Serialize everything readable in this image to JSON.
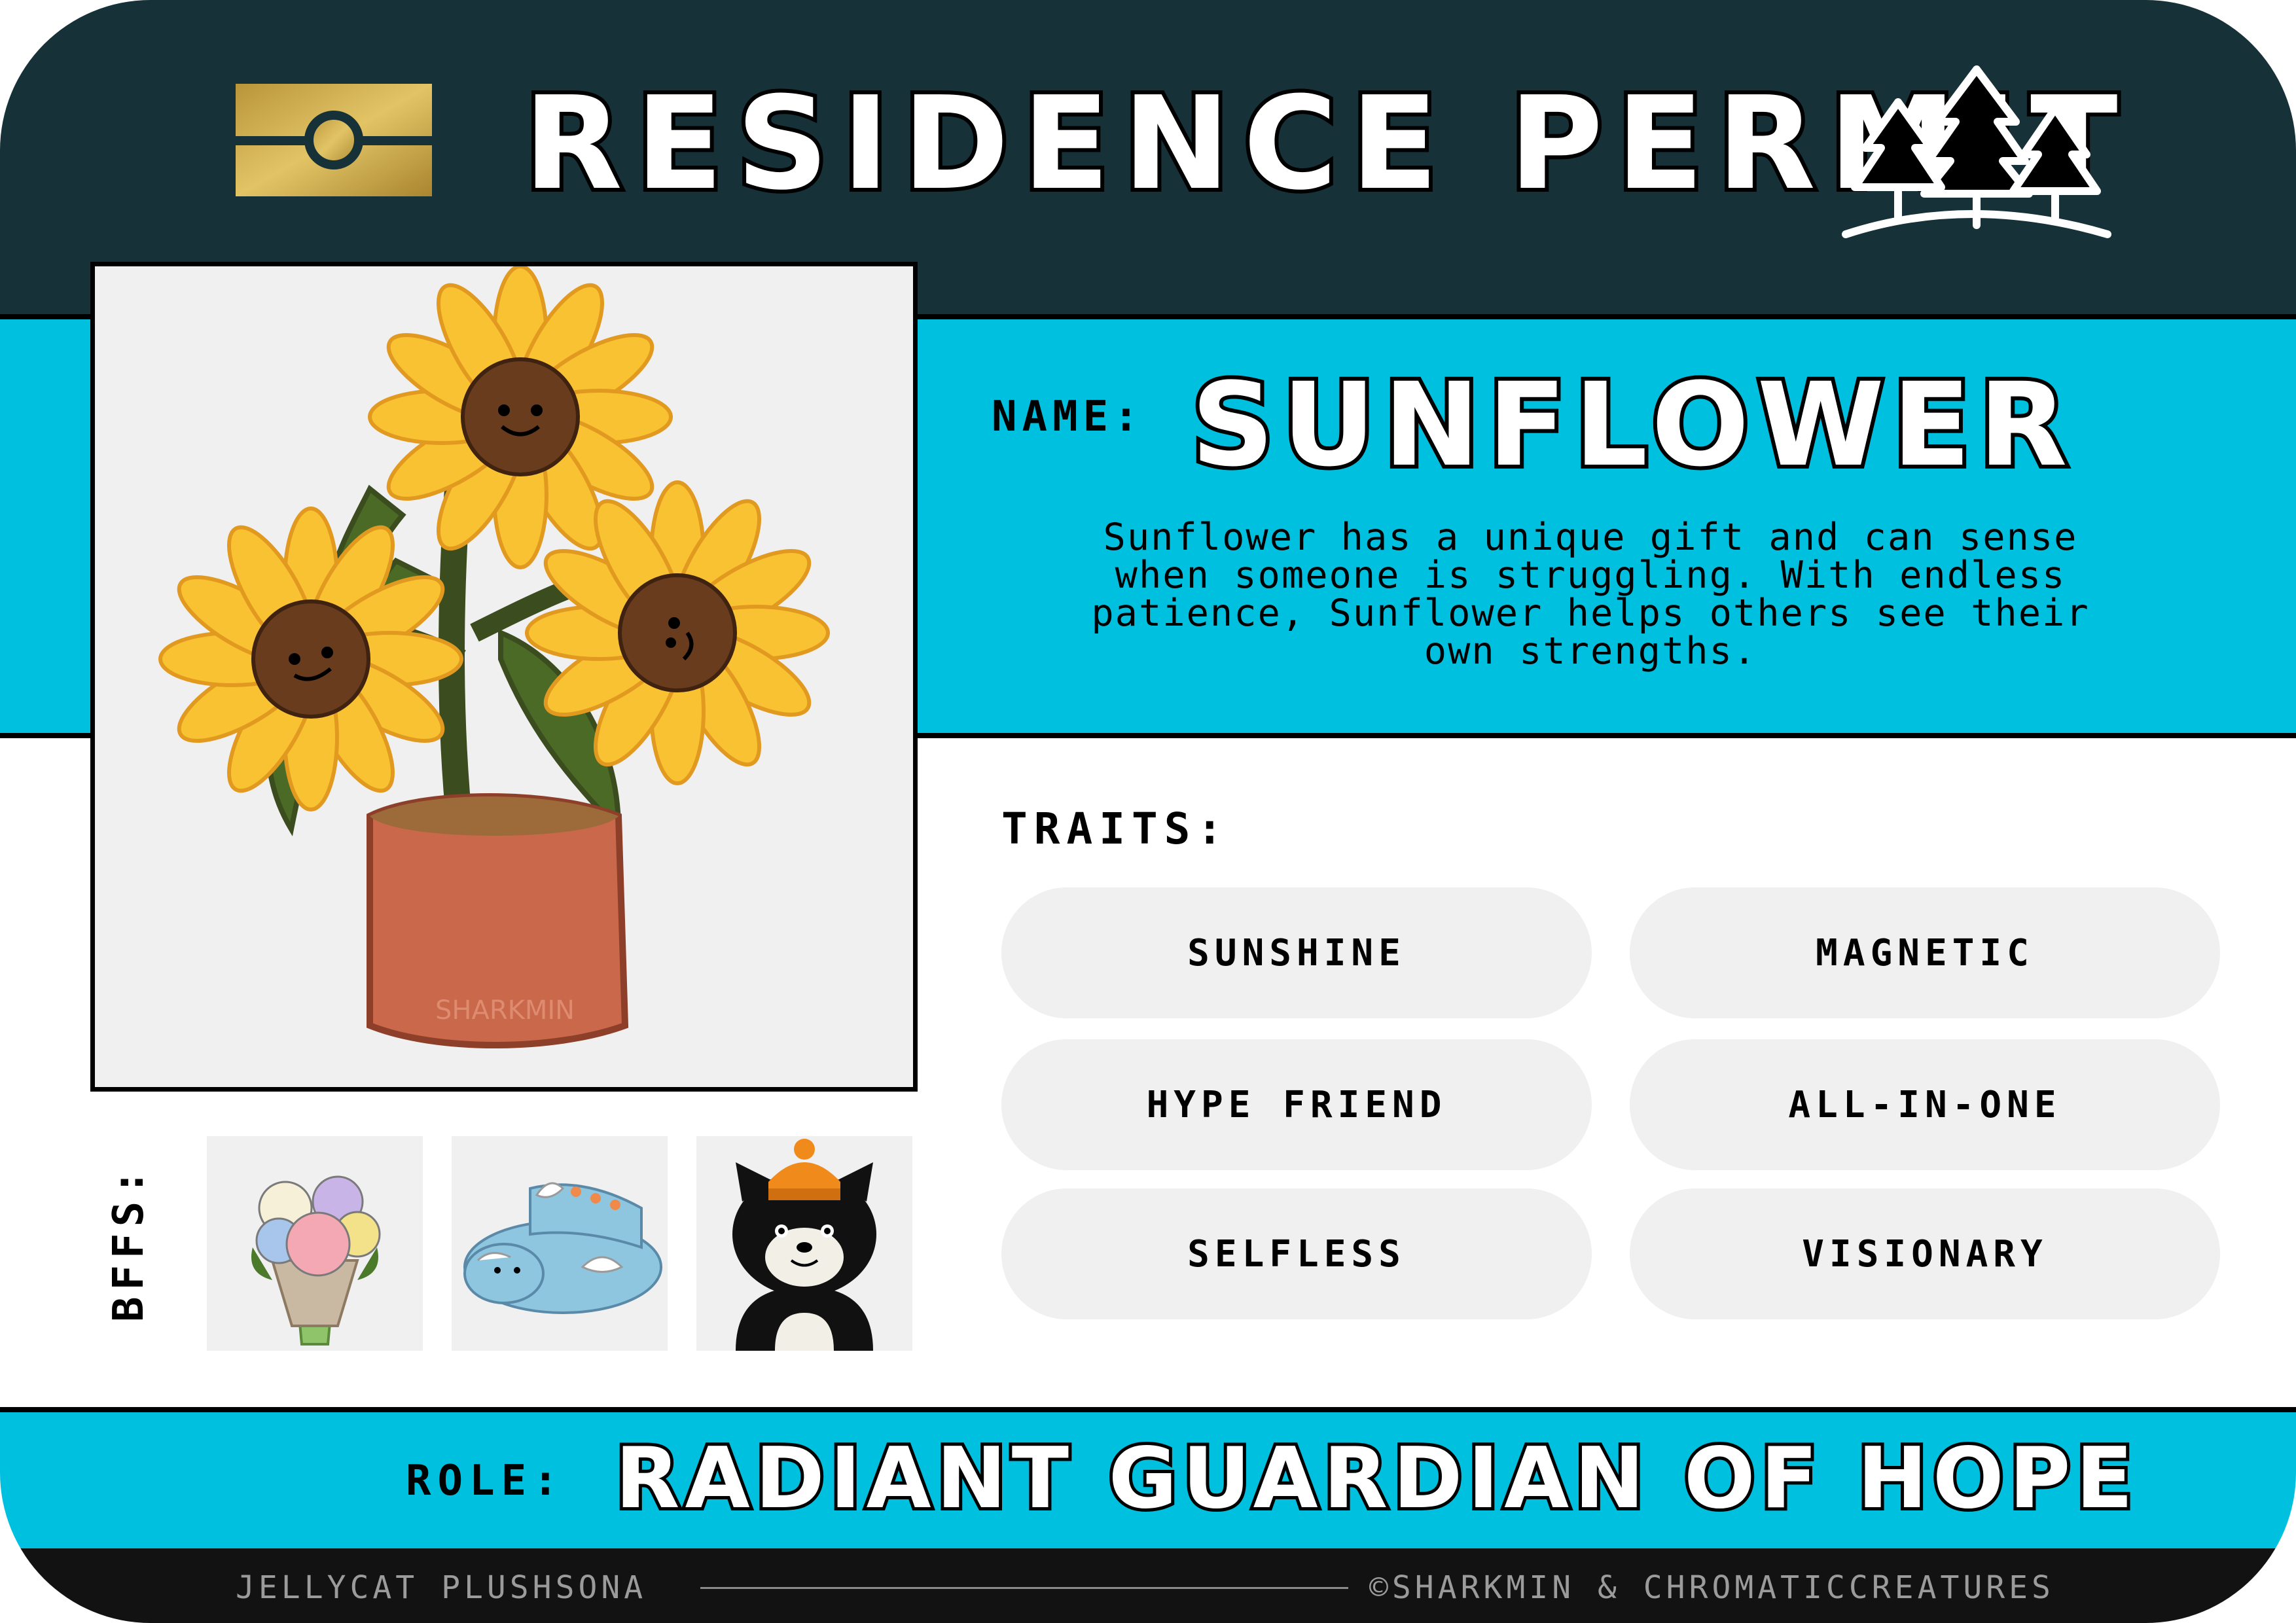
{
  "header": {
    "title": "RESIDENCE PERMIT",
    "flag_icon": "gold-flag-icon",
    "trees_icon": "pine-trees-icon"
  },
  "profile": {
    "name_label": "NAME:",
    "name": "SUNFLOWER",
    "description": "Sunflower has a unique gift and can sense when someone is struggling. With endless patience, Sunflower helps others see their own strengths.",
    "photo": "sunflower-plush-illustration",
    "photo_signature": "SHARKMIN"
  },
  "traits": {
    "label": "TRAITS:",
    "items": [
      "SUNSHINE",
      "MAGNETIC",
      "HYPE FRIEND",
      "ALL-IN-ONE",
      "SELFLESS",
      "VISIONARY"
    ]
  },
  "bffs": {
    "label": "BFFS:",
    "items": [
      "flower-bouquet-plush",
      "blue-dragon-plush",
      "black-cat-plush"
    ]
  },
  "role": {
    "label": "ROLE:",
    "value": "RADIANT GUARDIAN OF HOPE"
  },
  "footer": {
    "left": "JELLYCAT PLUSHSONA",
    "right": "©SHARKMIN & CHROMATICCREATURES"
  },
  "colors": {
    "dark_band": "#163138",
    "blue_band": "#00c0df",
    "footer_band": "#121212",
    "gold": "#c9a83f",
    "pill": "#f0f0f0"
  }
}
